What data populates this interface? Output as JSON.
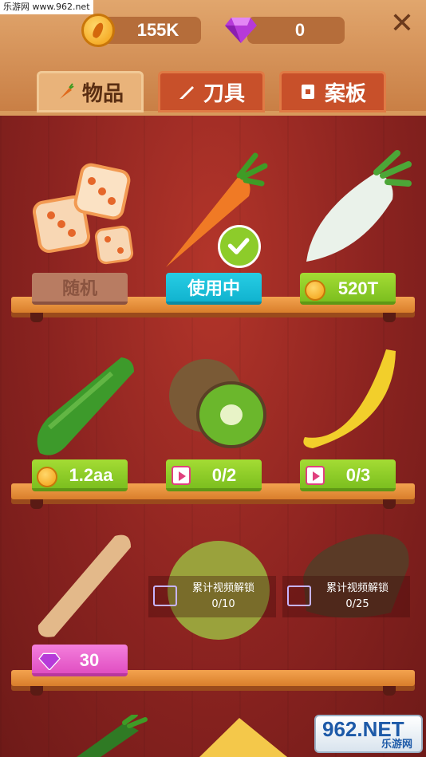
{
  "watermark": "乐游网 www.962.net",
  "currency": {
    "coins": "155K",
    "gems": "0"
  },
  "close_glyph": "✕",
  "tabs": [
    {
      "label": "物品",
      "icon": "carrot-icon",
      "active": true
    },
    {
      "label": "刀具",
      "icon": "knife-icon",
      "active": false
    },
    {
      "label": "案板",
      "icon": "board-icon",
      "active": false
    }
  ],
  "items": [
    {
      "name": "dice",
      "button": "随机",
      "style": "gray"
    },
    {
      "name": "carrot",
      "button": "使用中",
      "style": "cyan"
    },
    {
      "name": "radish",
      "button": "520T",
      "style": "green",
      "icon": "coin-icon"
    },
    {
      "name": "cucumber",
      "button": "1.2aa",
      "style": "green",
      "icon": "coin-icon"
    },
    {
      "name": "kiwi",
      "button": "0/2",
      "style": "green",
      "icon": "video-icon"
    },
    {
      "name": "banana",
      "button": "0/3",
      "style": "green",
      "icon": "video-icon"
    },
    {
      "name": "bread-stick",
      "button": "30",
      "style": "pink",
      "icon": "gem-icon"
    },
    {
      "name": "melon",
      "lock_text": "累计视频解锁",
      "lock_progress": "0/10"
    },
    {
      "name": "bread",
      "lock_text": "累计视频解锁",
      "lock_progress": "0/25"
    }
  ],
  "badge": {
    "big": "962.NET",
    "small": "乐游网"
  },
  "colors": {
    "accent_green": "#7cbf1f",
    "accent_cyan": "#11b3cf",
    "accent_pink": "#e04fc2",
    "bg": "#8b2320"
  }
}
